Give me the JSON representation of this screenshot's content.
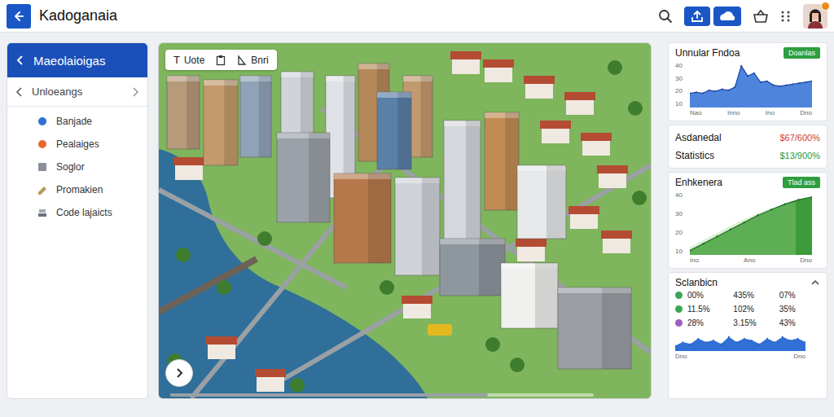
{
  "window": {
    "title": "Kadoganaia"
  },
  "sidebar": {
    "title": "Maeolaioigas",
    "section": "Unloeangs",
    "items": [
      {
        "label": "Banjade",
        "kind": "dot",
        "color": "#2f6fd6"
      },
      {
        "label": "Pealaiges",
        "kind": "dot",
        "color": "#e8692a"
      },
      {
        "label": "Soglor",
        "kind": "square",
        "color": "#8a8f99"
      },
      {
        "label": "Promakien",
        "kind": "tag",
        "color": "#b89a5a"
      },
      {
        "label": "Code lajaicts",
        "kind": "stack",
        "color": "#6b7280"
      }
    ]
  },
  "map": {
    "tools": [
      {
        "kind": "text",
        "glyph": "T",
        "label": "Uote"
      },
      {
        "kind": "clipboard"
      },
      {
        "kind": "measure",
        "label": "Bnri"
      }
    ]
  },
  "trend_card": {
    "title": "Unnular Fndoa",
    "button": "Doanlas",
    "y_ticks": [
      "40",
      "30",
      "20",
      "10"
    ],
    "x_ticks": [
      "Nao",
      "Inno",
      "Ino",
      "Dno"
    ],
    "series": [
      14,
      15,
      14,
      17,
      16,
      18,
      17,
      20,
      41,
      31,
      34,
      25,
      26,
      22,
      21,
      22,
      23,
      24,
      25,
      26
    ]
  },
  "stats": [
    {
      "label": "Asdanedal",
      "value": "$67/600%",
      "color": "#d23a2a"
    },
    {
      "label": "Statistics",
      "value": "$13/900%",
      "color": "#1f9a3a"
    }
  ],
  "growth_card": {
    "title": "Enhkenera",
    "button": "Tlad ass",
    "y_ticks": [
      "40",
      "30",
      "20",
      "10"
    ],
    "x_ticks": [
      "Ino",
      "Ano",
      "Dno"
    ],
    "series": [
      3,
      8,
      13,
      18,
      23,
      28,
      32,
      36,
      39,
      41
    ]
  },
  "selection_card": {
    "title": "Sclanbicn",
    "expanded": true,
    "rows": [
      {
        "color": "#3aa655",
        "values": [
          "00%",
          "435%",
          "07%"
        ]
      },
      {
        "color": "#3aa655",
        "values": [
          "11.5%",
          "102%",
          "35%"
        ]
      },
      {
        "color": "#9b5fc0",
        "values": [
          "28%",
          "3.15%",
          "43%"
        ]
      }
    ],
    "x_ticks": [
      "Dno",
      "Dno"
    ],
    "series": [
      8,
      10,
      9,
      12,
      10,
      11,
      9,
      13,
      10,
      12,
      11,
      9,
      12,
      10,
      13,
      11,
      12,
      10
    ]
  }
}
